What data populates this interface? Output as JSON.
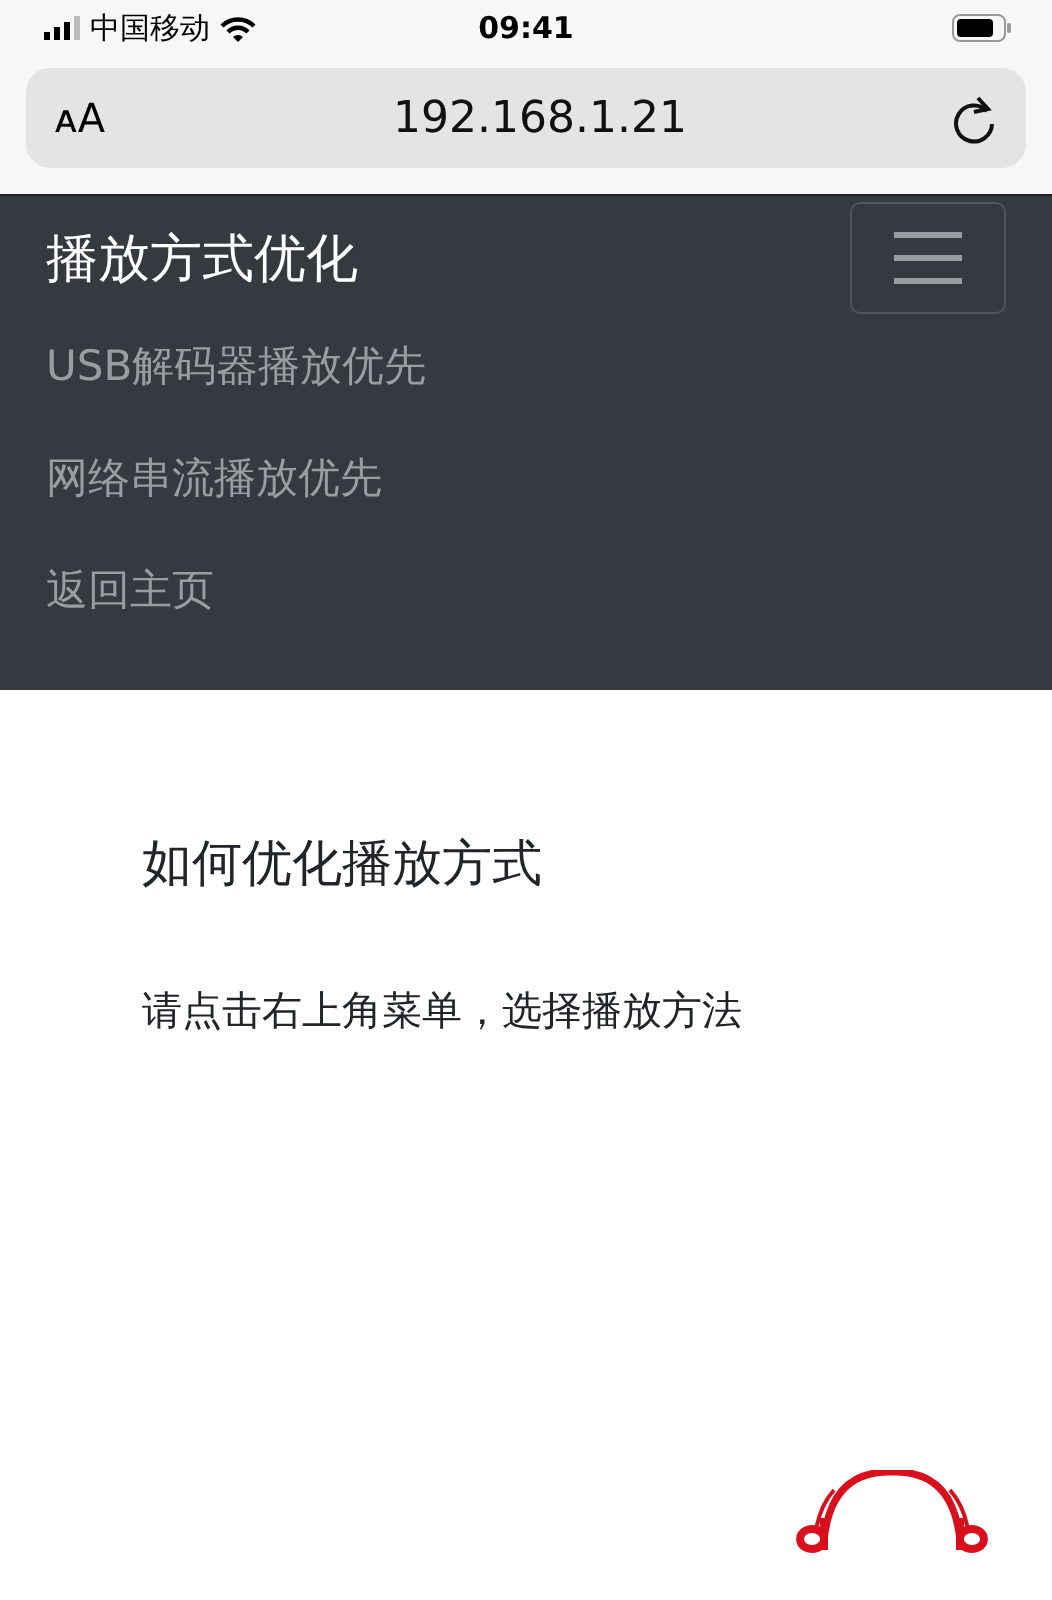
{
  "status_bar": {
    "carrier": "中国移动",
    "time": "09:41"
  },
  "address_bar": {
    "text_size_button": "ᴀA",
    "url": "192.168.1.21"
  },
  "navbar": {
    "brand": "播放方式优化",
    "menu_items": [
      {
        "label": "USB解码器播放优先"
      },
      {
        "label": "网络串流播放优先"
      },
      {
        "label": "返回主页"
      }
    ]
  },
  "content": {
    "heading": "如何优化播放方式",
    "text": "请点击右上角菜单，选择播放方法"
  }
}
